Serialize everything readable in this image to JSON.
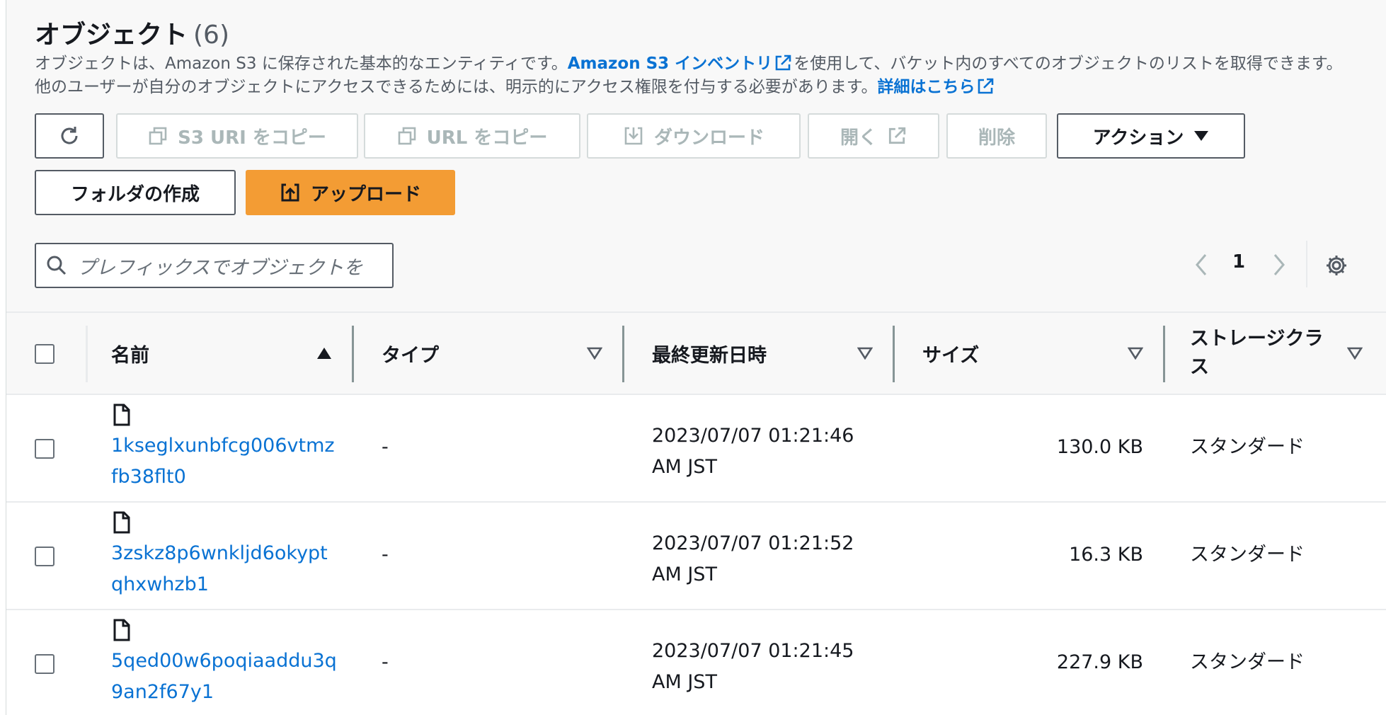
{
  "header": {
    "title": "オブジェクト",
    "count": "(6)",
    "desc_part1": "オブジェクトは、Amazon S3 に保存された基本的なエンティティです。",
    "desc_link1": "Amazon S3 インベントリ",
    "desc_part2": "を使用して、バケット内のすべてのオブジェクトのリストを取得できます。他のユーザーが自分のオブジェクトにアクセスできるためには、明示的にアクセス権限を付与する必要があります。",
    "desc_link2": "詳細はこちら"
  },
  "toolbar": {
    "copy_s3_uri": "S3 URI をコピー",
    "copy_url": "URL をコピー",
    "download": "ダウンロード",
    "open": "開く",
    "delete": "削除",
    "actions": "アクション",
    "create_folder": "フォルダの作成",
    "upload": "アップロード"
  },
  "search": {
    "placeholder": "プレフィックスでオブジェクトを"
  },
  "pagination": {
    "current_page": "1"
  },
  "table": {
    "columns": {
      "name": "名前",
      "type": "タイプ",
      "modified": "最終更新日時",
      "size": "サイズ",
      "storage_class": "ストレージクラス"
    },
    "rows": [
      {
        "name": "1kseglxunbfcg006vtmzfb38flt0",
        "type": "-",
        "modified": "2023/07/07 01:21:46 AM JST",
        "size": "130.0 KB",
        "storage_class": "スタンダード"
      },
      {
        "name": "3zskz8p6wnkljd6okyptqhxwhzb1",
        "type": "-",
        "modified": "2023/07/07 01:21:52 AM JST",
        "size": "16.3 KB",
        "storage_class": "スタンダード"
      },
      {
        "name": "5qed00w6poqiaaddu3q9an2f67y1",
        "type": "-",
        "modified": "2023/07/07 01:21:45 AM JST",
        "size": "227.9 KB",
        "storage_class": "スタンダード"
      }
    ]
  },
  "colors": {
    "link": "#0972d3",
    "primary_button": "#f39c34",
    "text": "#16191f",
    "disabled": "#aab7b8"
  },
  "icons": [
    "refresh-icon",
    "copy-icon",
    "download-icon",
    "external-link-icon",
    "caret-down-icon",
    "upload-icon",
    "search-icon",
    "chevron-left-icon",
    "chevron-right-icon",
    "gear-icon",
    "sort-ascending-icon",
    "sort-icon",
    "file-icon"
  ]
}
